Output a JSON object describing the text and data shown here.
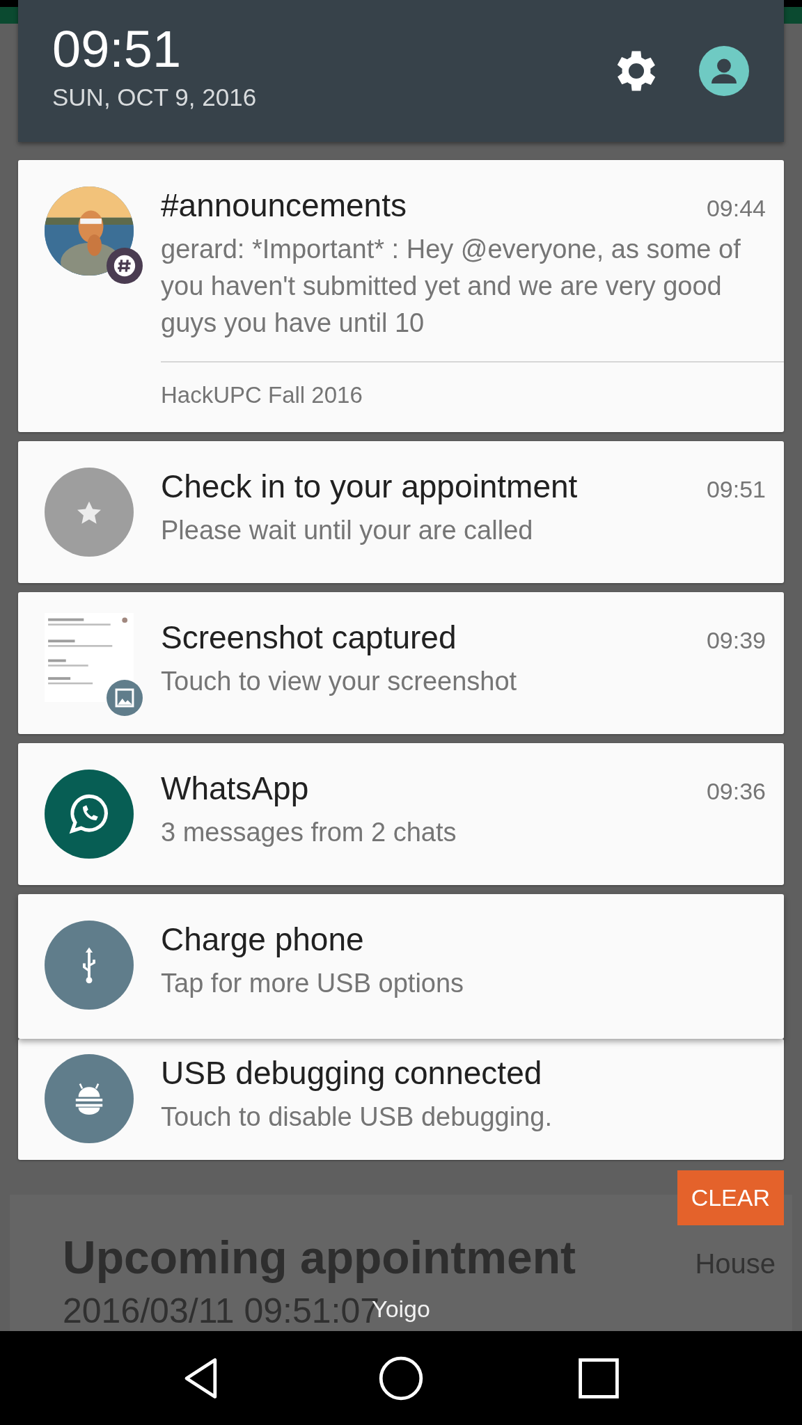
{
  "header": {
    "time": "09:51",
    "date": "SUN, OCT 9, 2016"
  },
  "notifications": [
    {
      "title": "#announcements",
      "time": "09:44",
      "body": "gerard: *Important* : Hey @everyone, as some of you haven't submitted yet and we are very good guys you have until 10",
      "subtext": "HackUPC Fall 2016"
    },
    {
      "kind": "star",
      "color": "#9e9e9e",
      "title": "Check in to your appointment",
      "time": "09:51",
      "body": "Please wait until your are called"
    },
    {
      "kind": "thumbnail",
      "title": "Screenshot captured",
      "time": "09:39",
      "body": "Touch to view your screenshot"
    },
    {
      "kind": "whatsapp",
      "color": "#075e54",
      "title": "WhatsApp",
      "time": "09:36",
      "body": "3 messages from 2 chats"
    },
    {
      "kind": "usb",
      "color": "#607d8b",
      "title": "Charge phone",
      "body": "Tap for more USB options"
    },
    {
      "kind": "android",
      "color": "#607d8b",
      "title": "USB debugging connected",
      "body": "Touch to disable USB debugging."
    }
  ],
  "clear_button": "CLEAR",
  "background_app": {
    "title": "Upcoming appointment",
    "location": "House",
    "datetime": "2016/03/11 09:51:07"
  },
  "carrier": "Yoigo"
}
